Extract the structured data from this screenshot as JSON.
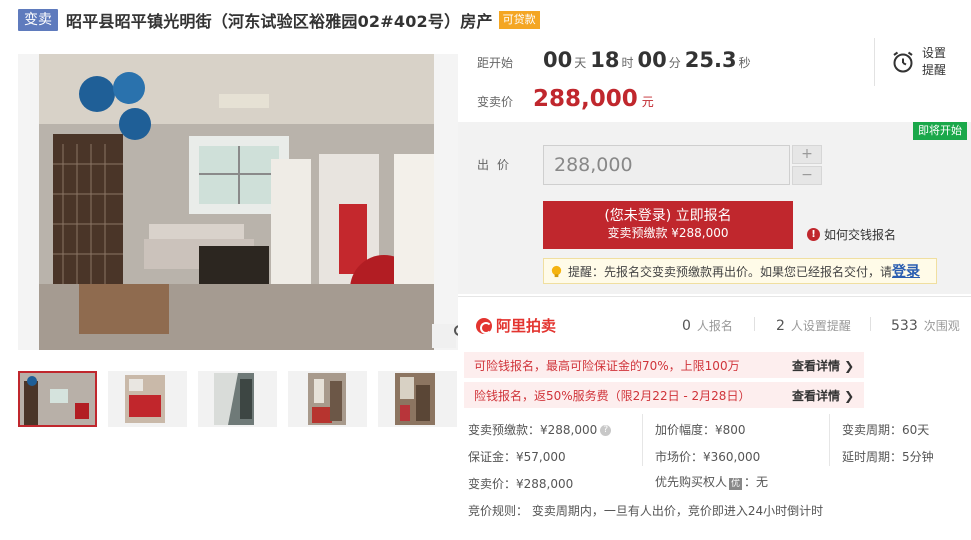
{
  "header": {
    "tag": "变卖",
    "title": "昭平县昭平镇光明街（河东试验区裕雅园02#402号）房产",
    "loan_tag": "可贷款"
  },
  "gallery": {
    "thumbnail_count": 5
  },
  "countdown": {
    "label": "距开始",
    "days": "00",
    "day_unit": "天",
    "hours": "18",
    "hour_unit": "时",
    "minutes": "00",
    "minute_unit": "分",
    "seconds": "25.3",
    "second_unit": "秒"
  },
  "reminder": {
    "line1": "设置",
    "line2": "提醒"
  },
  "price": {
    "label": "变卖价",
    "value": "288,000",
    "unit": "元"
  },
  "bid": {
    "status_badge": "即将开始",
    "label": "出价",
    "input_value": "288,000",
    "plus": "+",
    "minus": "−",
    "signup_main": "(您未登录) 立即报名",
    "signup_sub": "变卖预缴款 ¥288,000",
    "how_to_pay": "如何交钱报名",
    "tip": "提醒：先报名交变卖预缴款再出价。如果您已经报名交付，请",
    "tip_link": "登录"
  },
  "stats": {
    "platform": "阿里拍卖",
    "signups_count": "0",
    "signups_label": "人报名",
    "reminders_count": "2",
    "reminders_label": "人设置提醒",
    "views_count": "533",
    "views_label": "次围观"
  },
  "promos": [
    {
      "text": "可险钱报名，最高可险保证金的70%，上限100万",
      "link": "查看详情 ❯"
    },
    {
      "text": "险钱报名，返50%服务费（限2月22日 - 2月28日）",
      "link": "查看详情 ❯"
    }
  ],
  "details": {
    "deposit_prepay": "变卖预缴款：¥288,000",
    "increment": "加价幅度：¥800",
    "period": "变卖周期：60天",
    "bond": "保证金：¥57,000",
    "market_price": "市场价：¥360,000",
    "delay": "延时周期：5分钟",
    "sale_price": "变卖价：¥288,000",
    "preemptive_prefix": "优先购买权人",
    "preemptive_tag": "优",
    "preemptive_value": "：无",
    "rules": "竞价规则： 变卖周期内，一旦有人出价，竞价即进入24小时倒计时"
  }
}
